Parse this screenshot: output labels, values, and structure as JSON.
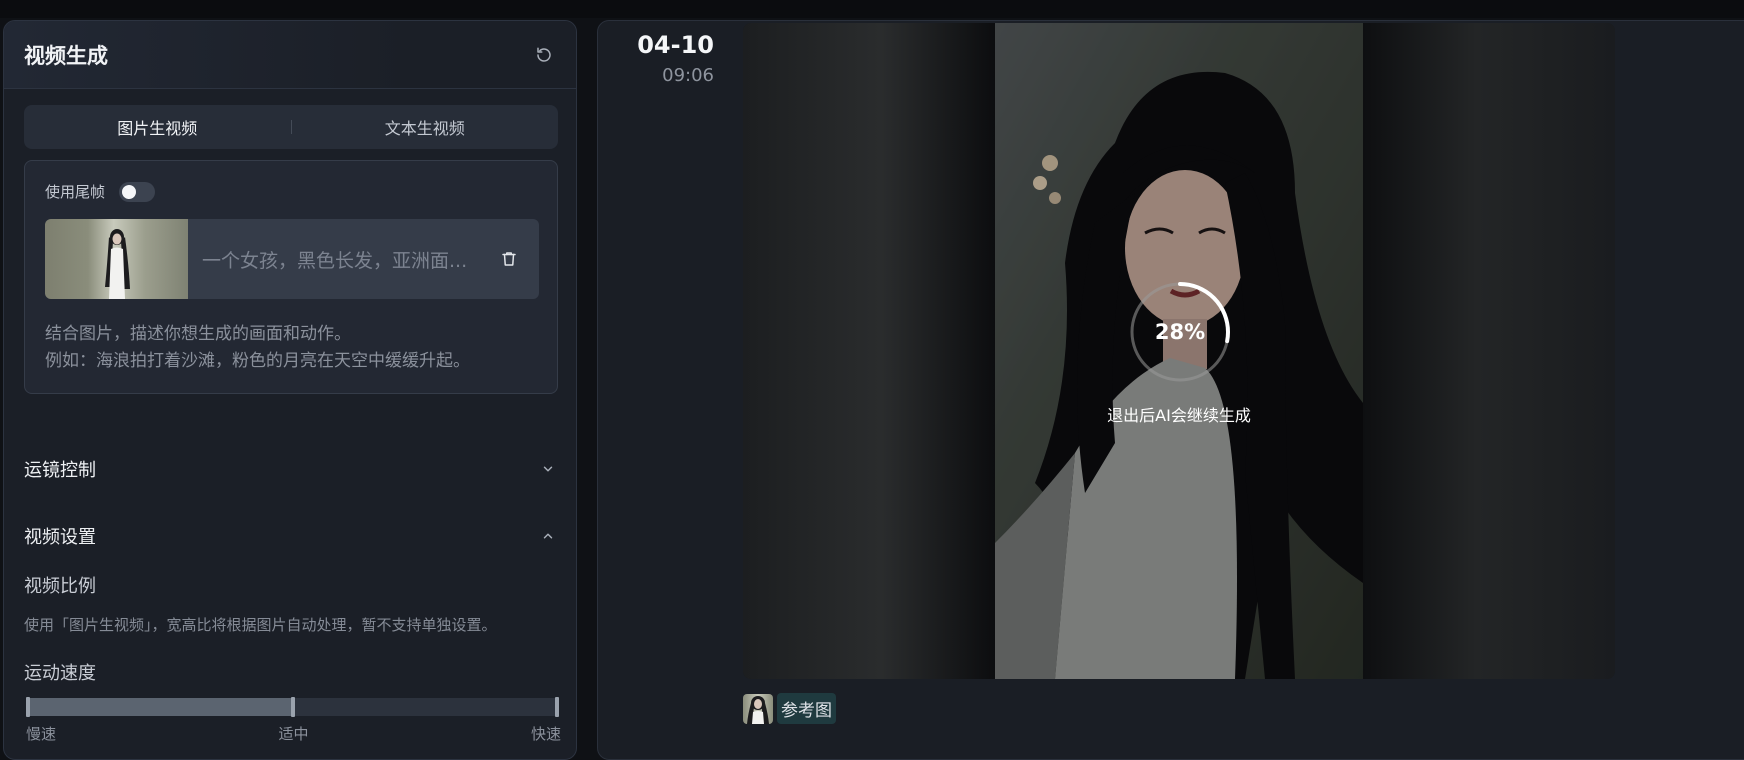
{
  "panel": {
    "title": "视频生成"
  },
  "tabs": [
    {
      "label": "图片生视频",
      "active": true
    },
    {
      "label": "文本生视频",
      "active": false
    }
  ],
  "upload": {
    "tail_frame_label": "使用尾帧",
    "tail_frame_enabled": false,
    "prompt_text": "一个女孩，黑色长发，亚洲面...",
    "hint_line1": "结合图片，描述你想生成的画面和动作。",
    "hint_line2": "例如：海浪拍打着沙滩，粉色的月亮在天空中缓缓升起。"
  },
  "sections": {
    "camera": {
      "title": "运镜控制",
      "expanded": false
    },
    "video": {
      "title": "视频设置",
      "expanded": true
    }
  },
  "video_settings": {
    "ratio_title": "视频比例",
    "ratio_desc": "使用「图片生视频」，宽高比将根据图片自动处理，暂不支持单独设置。",
    "speed_title": "运动速度",
    "speed_value": 0.5,
    "speed_labels": [
      "慢速",
      "适中",
      "快速"
    ]
  },
  "task": {
    "date": "04-10",
    "time": "09:06",
    "progress_text": "28%",
    "progress_value": 0.28,
    "progress_note": "退出后AI会继续生成",
    "ref_label": "参考图"
  },
  "icons": {
    "refresh": "refresh-icon",
    "trash": "trash-icon",
    "chevron_down": "chevron-down-icon",
    "chevron_up": "chevron-up-icon"
  },
  "colors": {
    "background": "#0f1115",
    "panel": "#1b1f27",
    "accent_ref": "#1f3a3f"
  }
}
